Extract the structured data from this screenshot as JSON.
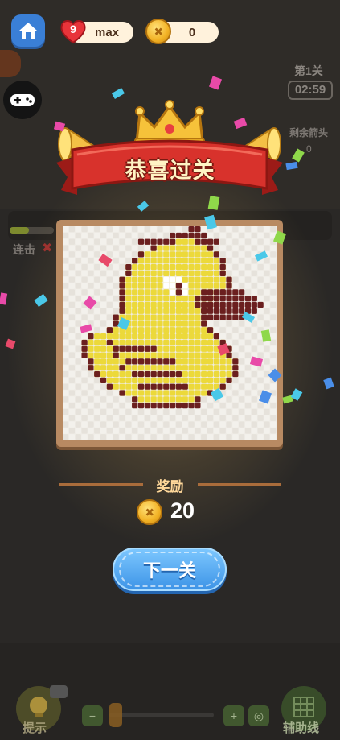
{
  "top_bar": {
    "lives": "9",
    "lives_label": "max",
    "coins": "0"
  },
  "level": {
    "label": "第1关",
    "timer": "02:59",
    "remaining_label": "剩余箭头",
    "remaining_value": "0"
  },
  "combo": {
    "label": "连击"
  },
  "popup": {
    "title": "恭喜过关",
    "reward_label": "奖励",
    "reward_value": "20",
    "next_button": "下一关"
  },
  "toolbar": {
    "hint_label": "提示",
    "guide_label": "辅助线"
  },
  "icons": [
    "home-icon",
    "heart-icon",
    "coin-icon",
    "gamepad-icon",
    "crown-icon",
    "zoom-out-icon",
    "zoom-in-icon",
    "target-icon",
    "video-icon",
    "bulb-icon",
    "grid-icon"
  ],
  "colors": {
    "accent_blue": "#3b92e6",
    "banner_red": "#d8322c",
    "duck_yellow": "#f2e03a",
    "duck_outline": "#6b1f1f",
    "coin_gold": "#f2b225"
  }
}
